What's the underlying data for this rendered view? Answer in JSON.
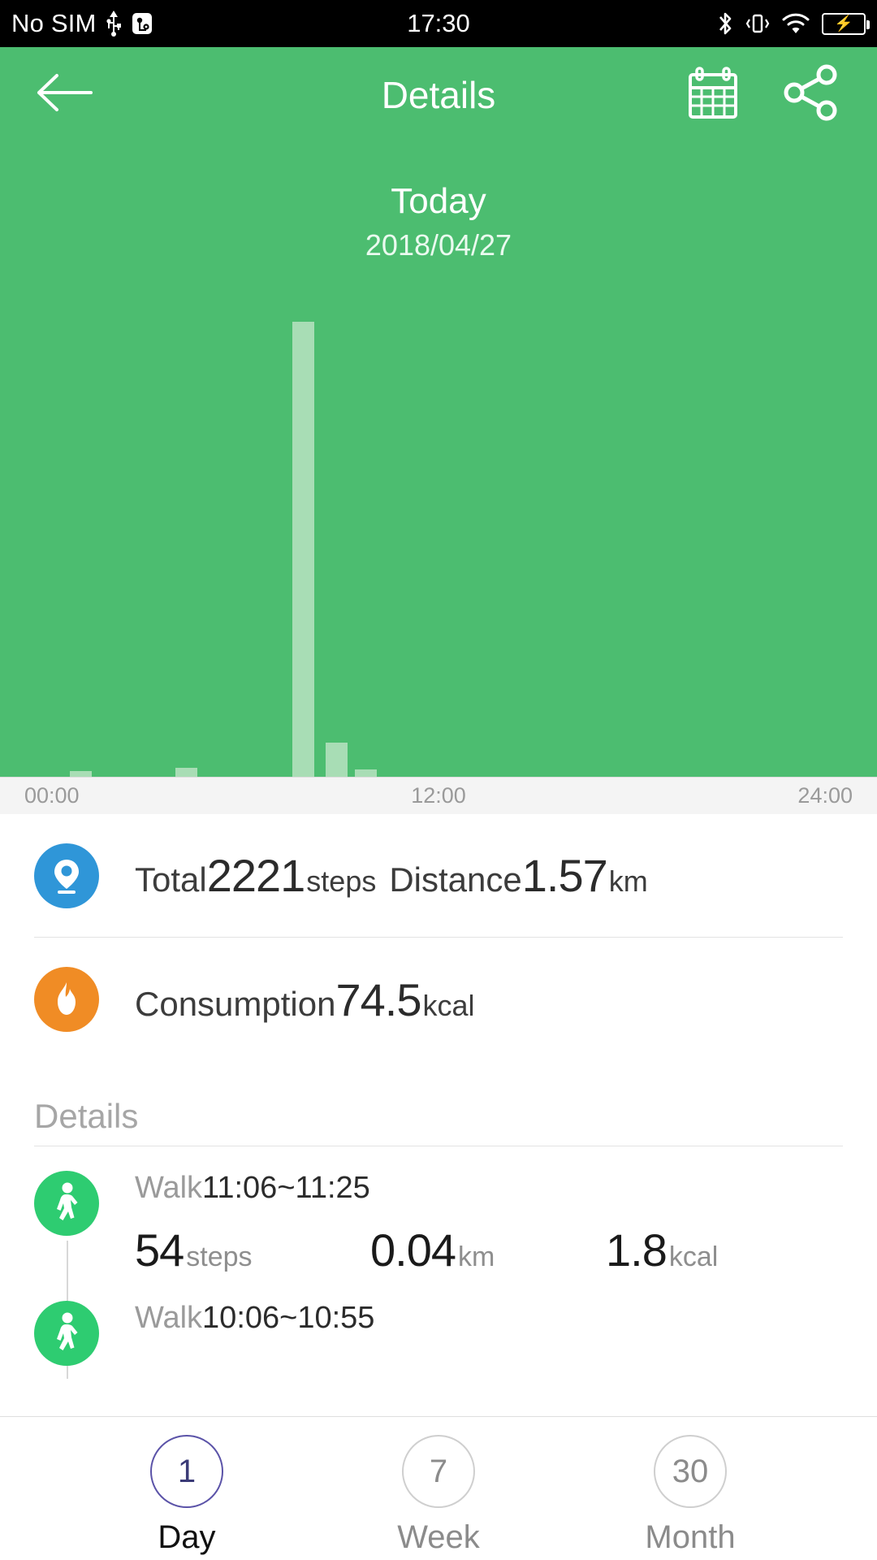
{
  "statusbar": {
    "carrier": "No SIM",
    "time": "17:30",
    "icons": [
      "usb-icon",
      "usb-debug-icon",
      "bluetooth-icon",
      "vibrate-icon",
      "wifi-icon",
      "battery-charging-icon"
    ]
  },
  "header": {
    "title": "Details",
    "back_icon": "back-arrow-icon",
    "calendar_icon": "calendar-icon",
    "share_icon": "share-icon"
  },
  "chart_header": {
    "day": "Today",
    "date": "2018/04/27"
  },
  "chart_data": {
    "type": "bar",
    "title": "Today",
    "subtitle": "2018/04/27",
    "xlabel": "",
    "ylabel": "",
    "xlim": [
      0,
      24
    ],
    "ylim": [
      0,
      560
    ],
    "grid": false,
    "legend": "none",
    "bar_color": "#A8DDB5",
    "background_color": "#4CBD70",
    "tick_labels": [
      "00:00",
      "12:00",
      "24:00"
    ],
    "x": [
      1.9,
      4.8,
      8.0,
      8.9,
      9.7
    ],
    "values": [
      7,
      11,
      560,
      42,
      9
    ],
    "categories": [
      "01:54",
      "04:48",
      "08:00",
      "08:54",
      "09:42"
    ]
  },
  "summary": {
    "steps_row": {
      "icon": "location-pin-icon",
      "icon_color": "#2F96D8",
      "total_label": "Total",
      "total_value": "2221",
      "total_unit": "steps",
      "distance_label": "Distance",
      "distance_value": "1.57",
      "distance_unit": "km"
    },
    "calories_row": {
      "icon": "flame-icon",
      "icon_color": "#F08C25",
      "label": "Consumption",
      "value": "74.5",
      "unit": "kcal"
    }
  },
  "details": {
    "heading": "Details",
    "entries": [
      {
        "icon": "walking-person-icon",
        "activity": "Walk",
        "time_range": "11:06~11:25",
        "steps_value": "54",
        "steps_unit": "steps",
        "distance_value": "0.04",
        "distance_unit": "km",
        "calories_value": "1.8",
        "calories_unit": "kcal"
      },
      {
        "icon": "walking-person-icon",
        "activity": "Walk",
        "time_range": "10:06~10:55"
      }
    ]
  },
  "bottomnav": {
    "items": [
      {
        "number": "1",
        "label": "Day",
        "active": true
      },
      {
        "number": "7",
        "label": "Week",
        "active": false
      },
      {
        "number": "30",
        "label": "Month",
        "active": false
      }
    ]
  }
}
